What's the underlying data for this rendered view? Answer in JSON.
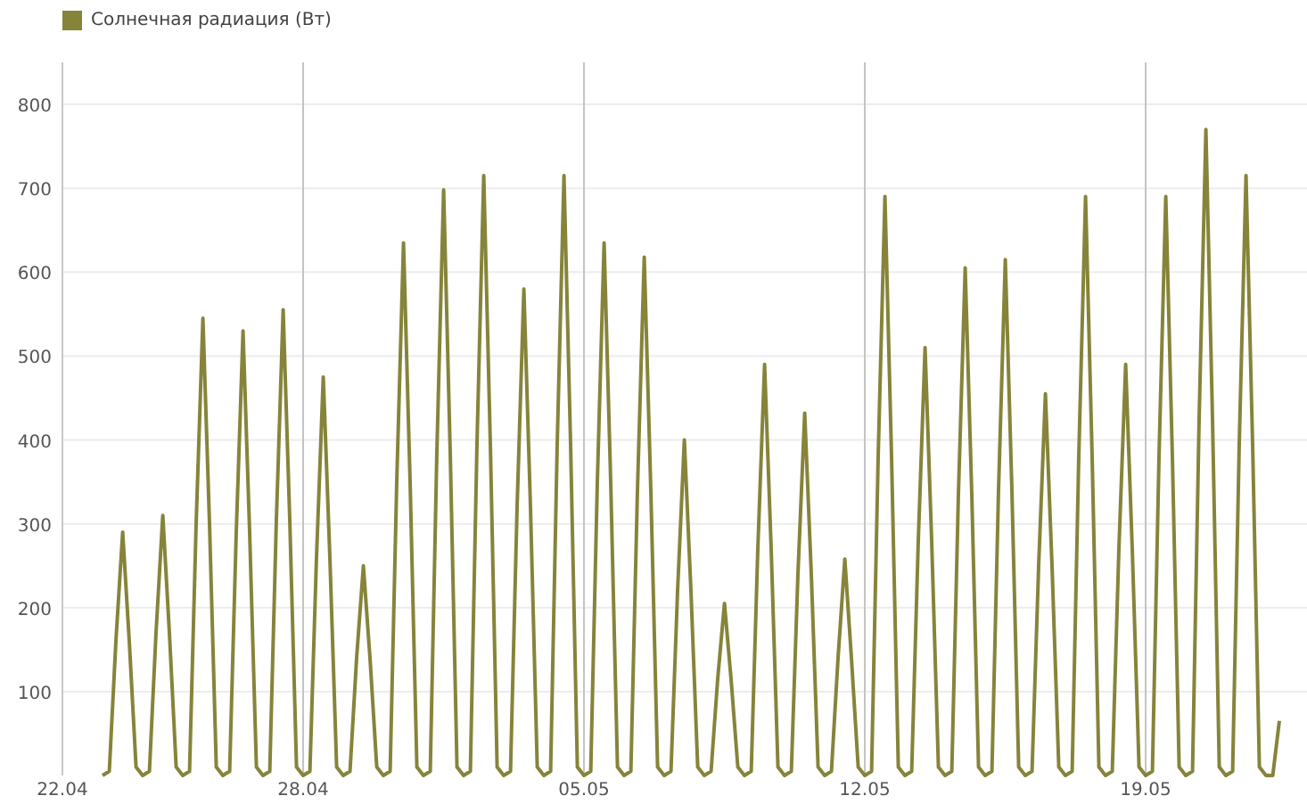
{
  "chart_data": {
    "type": "line",
    "grid": true,
    "ylim": [
      0,
      850
    ],
    "yticks": [
      100,
      200,
      300,
      400,
      500,
      600,
      700,
      800
    ],
    "categories": [
      "22.04",
      null,
      null,
      null,
      null,
      null,
      null,
      null,
      null,
      null,
      null,
      null,
      null,
      null,
      null,
      null,
      null,
      null,
      null,
      null,
      null,
      null,
      null,
      null,
      null,
      null,
      null,
      null,
      null,
      null,
      null,
      null,
      null,
      null,
      null,
      null,
      "28.04",
      null,
      null,
      null,
      null,
      null,
      null,
      null,
      null,
      null,
      null,
      null,
      null,
      null,
      null,
      null,
      null,
      null,
      null,
      null,
      null,
      null,
      null,
      null,
      null,
      null,
      null,
      null,
      null,
      null,
      null,
      null,
      null,
      null,
      null,
      null,
      null,
      null,
      null,
      null,
      null,
      null,
      "05.05",
      null,
      null,
      null,
      null,
      null,
      null,
      null,
      null,
      null,
      null,
      null,
      null,
      null,
      null,
      null,
      null,
      null,
      null,
      null,
      null,
      null,
      null,
      null,
      null,
      null,
      null,
      null,
      null,
      null,
      null,
      null,
      null,
      null,
      null,
      null,
      null,
      null,
      null,
      null,
      null,
      null,
      "12.05",
      null,
      null,
      null,
      null,
      null,
      null,
      null,
      null,
      null,
      null,
      null,
      null,
      null,
      null,
      null,
      null,
      null,
      null,
      null,
      null,
      null,
      null,
      null,
      null,
      null,
      null,
      null,
      null,
      null,
      null,
      null,
      null,
      null,
      null,
      null,
      null,
      null,
      null,
      null,
      null,
      null,
      "19.05",
      null,
      null,
      null,
      null,
      null,
      null,
      null,
      null,
      null,
      null,
      null,
      null,
      null,
      null,
      null,
      null,
      null,
      null,
      null,
      null
    ],
    "series": [
      {
        "name": "Солнечная радиация (Вт)",
        "color": "#85843a",
        "values": [
          null,
          null,
          null,
          null,
          null,
          null,
          0,
          5,
          160,
          290,
          160,
          10,
          0,
          5,
          170,
          310,
          170,
          10,
          0,
          5,
          300,
          545,
          300,
          10,
          0,
          5,
          290,
          530,
          290,
          10,
          0,
          5,
          305,
          555,
          305,
          10,
          0,
          5,
          260,
          475,
          260,
          10,
          0,
          5,
          140,
          250,
          140,
          10,
          0,
          5,
          350,
          635,
          350,
          10,
          0,
          5,
          385,
          698,
          385,
          10,
          0,
          5,
          395,
          715,
          395,
          10,
          0,
          5,
          320,
          580,
          320,
          10,
          0,
          5,
          395,
          715,
          395,
          10,
          0,
          5,
          350,
          635,
          350,
          10,
          0,
          5,
          340,
          618,
          340,
          10,
          0,
          5,
          220,
          400,
          220,
          10,
          0,
          5,
          115,
          205,
          115,
          10,
          0,
          5,
          270,
          490,
          270,
          10,
          0,
          5,
          240,
          432,
          240,
          10,
          0,
          5,
          140,
          258,
          140,
          10,
          0,
          5,
          380,
          690,
          380,
          10,
          0,
          5,
          280,
          510,
          280,
          10,
          0,
          5,
          335,
          605,
          335,
          10,
          0,
          5,
          340,
          615,
          340,
          10,
          0,
          5,
          250,
          455,
          250,
          10,
          0,
          5,
          380,
          690,
          380,
          10,
          0,
          5,
          270,
          490,
          270,
          10,
          0,
          5,
          380,
          690,
          380,
          10,
          0,
          5,
          425,
          770,
          425,
          10,
          0,
          5,
          395,
          715,
          395,
          10,
          0,
          0,
          65
        ]
      }
    ]
  }
}
